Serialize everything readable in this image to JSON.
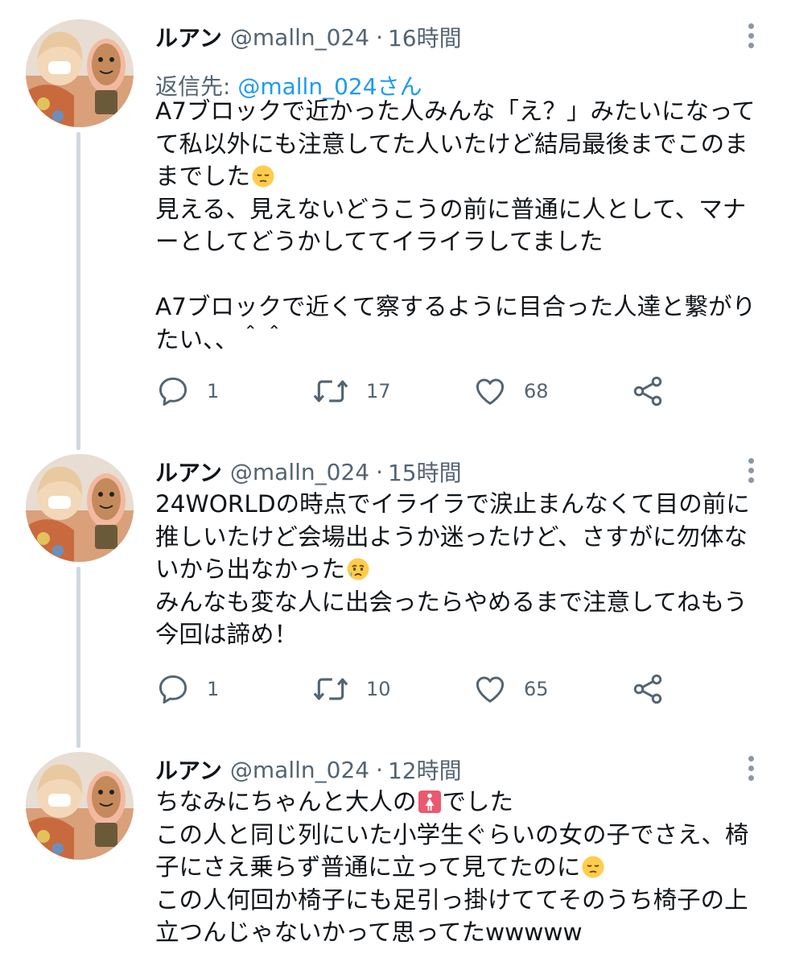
{
  "tweets": [
    {
      "name": "ルアン",
      "handle": "@malln_024",
      "dot": "·",
      "time": "16時間",
      "reply_prefix": "返信先: ",
      "reply_mention": "@malln_024さん",
      "lines": [
        "A7ブロックで近かった人みんな「え？」みたいになって",
        "て私以外にも注意してた人いたけど結局最後までこのま",
        "までした",
        "見える、見えないどうこうの前に普通に人として、マナ",
        "ーとしてどうかしててイライラしてました",
        "",
        "A7ブロックで近くて察するように目合った人達と繋がり",
        "たい、、＾＾"
      ],
      "emojis": [
        "pensive-emoji"
      ],
      "reply_count": "1",
      "retweet_count": "17",
      "like_count": "68"
    },
    {
      "name": "ルアン",
      "handle": "@malln_024",
      "dot": "·",
      "time": "15時間",
      "lines": [
        "24WORLDの時点でイライラで涙止まんなくて目の前に",
        "推しいたけど会場出ようか迷ったけど、さすがに勿体な",
        "いから出なかった",
        "みんなも変な人に出会ったらやめるまで注意してねもう",
        "今回は諦め！"
      ],
      "emojis": [
        "crying-emoji"
      ],
      "reply_count": "1",
      "retweet_count": "10",
      "like_count": "65"
    },
    {
      "name": "ルアン",
      "handle": "@malln_024",
      "dot": "·",
      "time": "12時間",
      "lines": [
        "ちなみにちゃんと大人の",
        "でした",
        "この人と同じ列にいた小学生ぐらいの女の子でさえ、椅",
        "子にさえ乗らず普通に立って見てたのに",
        "この人何回か椅子にも足引っ掛けててそのうち椅子の上",
        "立つんじゃないかって思ってたwwwww"
      ],
      "emojis": [
        "womens-room-emoji",
        "pensive-emoji"
      ]
    }
  ]
}
